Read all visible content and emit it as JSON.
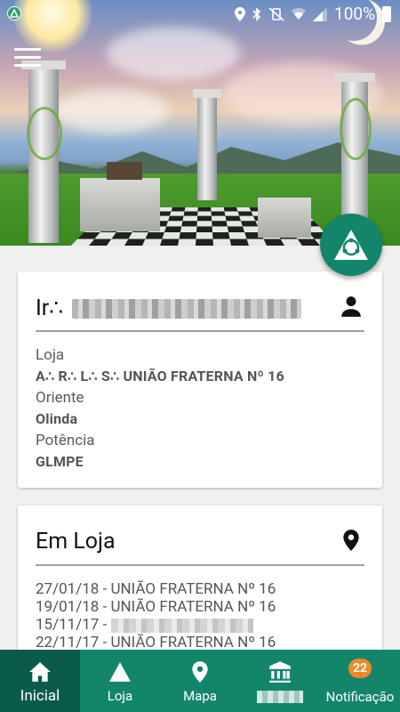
{
  "status_bar": {
    "battery": "100%"
  },
  "member_card": {
    "title_prefix": "Ir∴",
    "fields": [
      {
        "label": "Loja",
        "value": "A∴ R∴ L∴ S∴ UNIÃO FRATERNA Nº 16"
      },
      {
        "label": "Oriente",
        "value": "Olinda"
      },
      {
        "label": "Potência",
        "value": "GLMPE"
      }
    ]
  },
  "em_loja_card": {
    "title": "Em Loja",
    "visits": [
      {
        "date": "27/01/18",
        "text": "UNIÃO FRATERNA Nº 16"
      },
      {
        "date": "19/01/18",
        "text": "UNIÃO FRATERNA Nº 16"
      },
      {
        "date": "15/11/17",
        "text": ""
      },
      {
        "date": "22/11/17",
        "text": "UNIÃO FRATERNA Nº 16"
      }
    ]
  },
  "bottom_nav": {
    "items": [
      {
        "label": "Inicial",
        "icon": "home-icon",
        "active": true
      },
      {
        "label": "Loja",
        "icon": "triangle-icon"
      },
      {
        "label": "Mapa",
        "icon": "map-pin-icon"
      },
      {
        "label": "",
        "icon": "institution-icon"
      },
      {
        "label": "Notificação",
        "icon": "bell-icon",
        "badge": "22"
      }
    ]
  },
  "colors": {
    "primary": "#13856b",
    "primary_dark": "#0b5b4a",
    "badge": "#f08a28"
  }
}
